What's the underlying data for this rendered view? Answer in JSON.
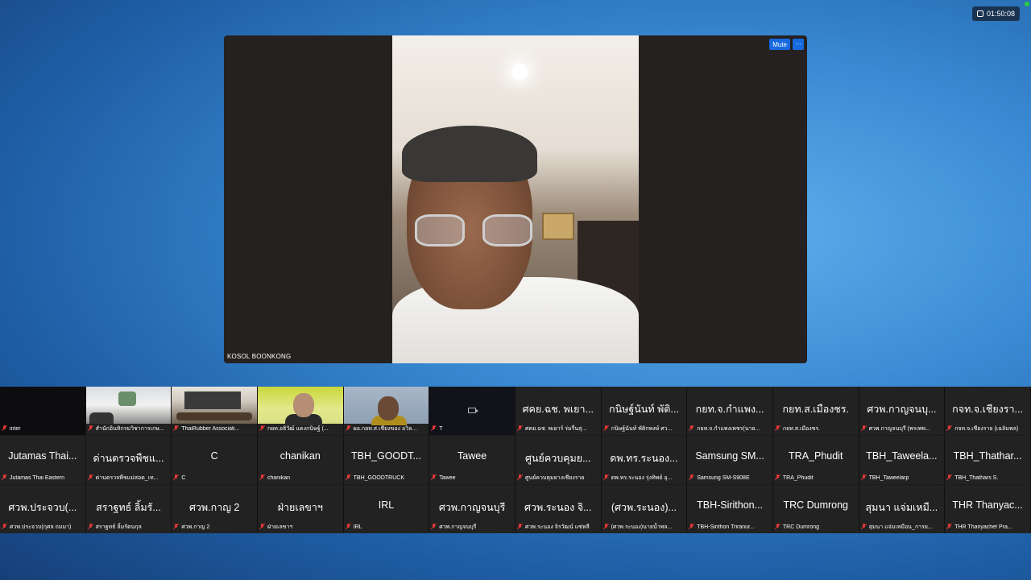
{
  "top_bar": {
    "timer": "01:50:08",
    "timer_icon": "clock-icon"
  },
  "main_video": {
    "speaker_name": "KOSOL BOONKONG",
    "mute_label": "Mute",
    "more_label": "···"
  },
  "gallery": {
    "row1": [
      {
        "display": "",
        "name": "inter",
        "video": "dark"
      },
      {
        "display": "",
        "name": "สำนักอินทิกรมวิชาการเกษ...",
        "video": "office"
      },
      {
        "display": "",
        "name": "ThaiRubber Associati...",
        "video": "meeting-room"
      },
      {
        "display": "",
        "name": "กยท.อธิวัฒ์ แดงกนิษฐ์ (...",
        "video": "person-green"
      },
      {
        "display": "",
        "name": "ผอ.กยท.ส.เชียงของ อวิล...",
        "video": "person-blue"
      },
      {
        "display": "",
        "name": "T",
        "video": "camera-off"
      },
      {
        "display": "ศคย.ฉช. พเยา...",
        "name": "ศคย.ฉช. พเยาร์ ร่มรื่นสุ...",
        "video": "none"
      },
      {
        "display": "กนิษฐ์นันท์ พัติ...",
        "name": "กนิษฐ์นันท์ พัติกพงษ์ ศว...",
        "video": "none"
      },
      {
        "display": "กยท.จ.กำแพง...",
        "name": "กยท.จ.กำแพงเพชร(นาย...",
        "video": "none"
      },
      {
        "display": "กยท.ส.เมืองชร.",
        "name": "กยท.ส.เมืองชร.",
        "video": "none"
      },
      {
        "display": "ศวพ.กาญจนบุ...",
        "name": "ศวพ.กาญจนบุรี (พรเพพ...",
        "video": "none"
      },
      {
        "display": "กจท.จ.เชียงรา...",
        "name": "กจท.จ.เชียงราย (เฉลิมพล)",
        "video": "none"
      }
    ],
    "row2": [
      {
        "display": "Jutamas Thai...",
        "name": "Jutamas Thai Eastern"
      },
      {
        "display": "ด่านตรวจพืชแ...",
        "name": "ด่านตรวจพืชแม่สอด_เท..."
      },
      {
        "display": "C",
        "name": "C"
      },
      {
        "display": "chanikan",
        "name": "chanikan"
      },
      {
        "display": "TBH_GOODT...",
        "name": "TBH_GOODTRUCK"
      },
      {
        "display": "Tawee",
        "name": "Tawee"
      },
      {
        "display": "ศูนย์ควบคุมย...",
        "name": "ศูนย์ควบคุมยางเชียงราย"
      },
      {
        "display": "ดพ.ทร.ระนอง...",
        "name": "ดพ.ทร.ระนอง รุ่งทิพย์ อุ..."
      },
      {
        "display": "Samsung SM...",
        "name": "Samsung SM-S908E"
      },
      {
        "display": "TRA_Phudit",
        "name": "TRA_Phudit"
      },
      {
        "display": "TBH_Taweela...",
        "name": "TBH_Taweelarp"
      },
      {
        "display": "TBH_Thathar...",
        "name": "TBH_Thathars S."
      }
    ],
    "row3": [
      {
        "display": "ศวพ.ประจวบ(...",
        "name": "ศวพ.ประจวบ(กุศล ถมมา)"
      },
      {
        "display": "สราฐทธ์ ลิ้มรั...",
        "name": "สราฐทธ์ ลิ้มรัตนกุล"
      },
      {
        "display": "ศวพ.กาญ 2",
        "name": "ศวพ.กาญ 2"
      },
      {
        "display": "ฝ่ายเลขาฯ",
        "name": "ฝ่ายเลขาฯ"
      },
      {
        "display": "IRL",
        "name": "IRL"
      },
      {
        "display": "ศวพ.กาญจนบุรี",
        "name": "ศวพ.กาญจนบุรี"
      },
      {
        "display": "ศวพ.ระนอง จิ...",
        "name": "ศวพ.ระนอง จิรวัฒน์ แซ่หลี"
      },
      {
        "display": "(ศวพ.ระนอง)...",
        "name": "(ศวพ.ระนอง)นายน้ำพล..."
      },
      {
        "display": "TBH-Sirithon...",
        "name": "TBH-Sirithon Triranur..."
      },
      {
        "display": "TRC Dumrong",
        "name": "TRC Dumrong"
      },
      {
        "display": "สุมนา แจ่มเหมื...",
        "name": "สุมนา แจ่มเหมือน_การย..."
      },
      {
        "display": "THR Thanyac...",
        "name": "THR Thanyachet Pra..."
      }
    ]
  },
  "icons": {
    "muted": "mic-off-icon",
    "camera_off": "camera-off-icon"
  },
  "colors": {
    "accent_button": "#1769e0",
    "muted_icon": "#e53935",
    "status_dot": "#2ecc40"
  }
}
